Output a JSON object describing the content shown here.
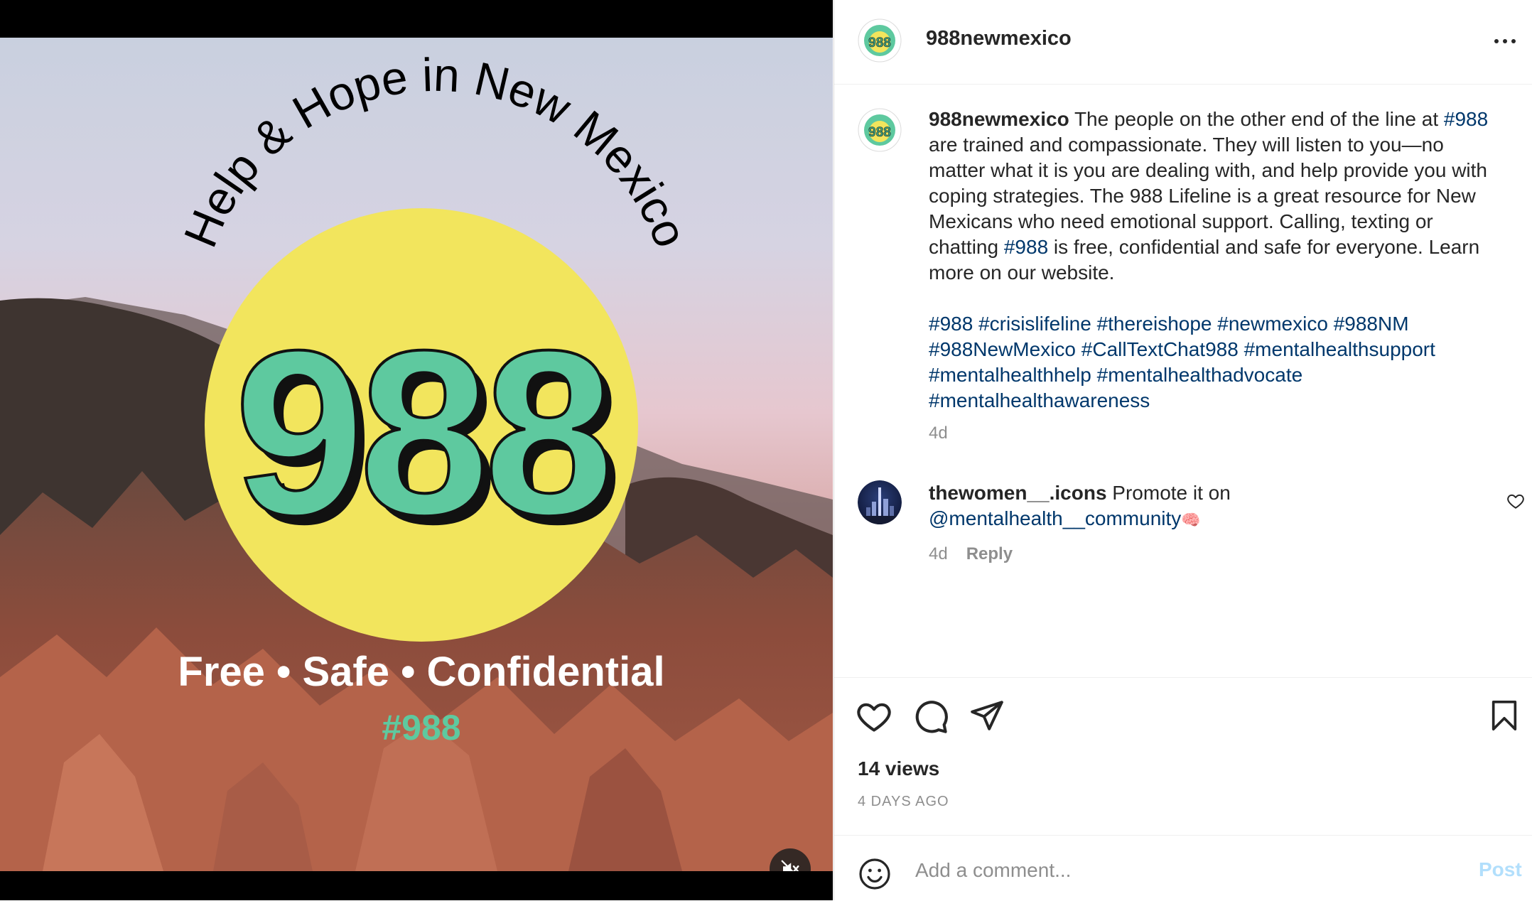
{
  "post": {
    "username": "988newmexico",
    "avatar_text": "988",
    "media": {
      "arc_text": "Help & Hope in New Mexico",
      "big_number": "988",
      "tagline": "Free • Safe • Confidential",
      "hashtag": "#988"
    },
    "caption": {
      "username": "988newmexico",
      "segment1": " The people on the other end of the line at ",
      "tag1": "#988",
      "segment2": " are trained and compassionate. They will listen to you—no matter what it is you are dealing with, and help provide you with coping strategies. The 988 Lifeline is a great resource for New Mexicans who need emotional support. Calling, texting or chatting ",
      "tag2": "#988",
      "segment3": " is free, confidential and safe for everyone. Learn more on our website.",
      "hashtags": [
        "#988",
        "#crisislifeline",
        "#thereishope",
        "#newmexico",
        "#988NM",
        "#988NewMexico",
        "#CallTextChat988",
        "#mentalhealthsupport",
        "#mentalhealthhelp",
        "#mentalhealthadvocate",
        "#mentalhealthawareness"
      ],
      "time": "4d"
    },
    "comment": {
      "username": "thewomen__.icons",
      "text": " Promote it on ",
      "mention": "@mentalhealth__community",
      "emoji": "🧠",
      "time": "4d",
      "reply_label": "Reply"
    },
    "views": "14 views",
    "date": "4 DAYS AGO",
    "add_comment_placeholder": "Add a comment...",
    "post_label": "Post"
  },
  "icons": {
    "more": "more-options-icon",
    "mute": "muted-speaker-icon",
    "like": "heart-icon",
    "comment": "comment-bubble-icon",
    "share": "paper-plane-icon",
    "save": "bookmark-icon",
    "emoji": "emoji-smiley-icon"
  },
  "colors": {
    "number_green": "#5ec99f",
    "sun_yellow": "#f2e55d",
    "link_blue": "#00376b",
    "post_disabled": "#b2dffc"
  }
}
